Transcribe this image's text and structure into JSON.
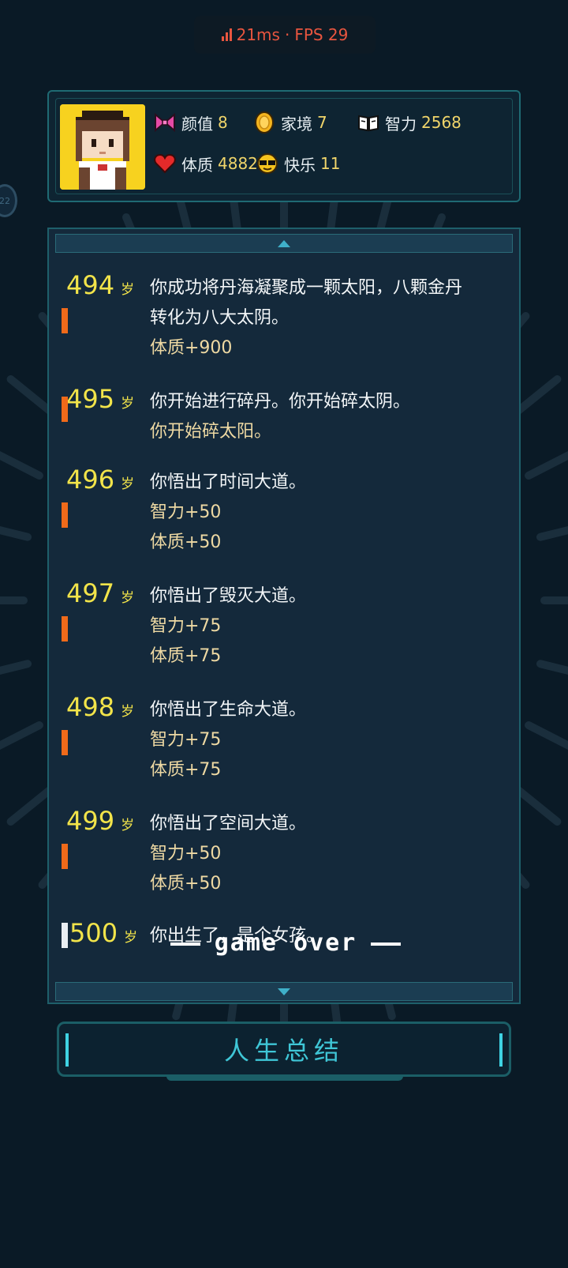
{
  "perf": {
    "latency": "21ms",
    "separator": "·",
    "fps": "FPS 29"
  },
  "side_badge": "22",
  "attributes": [
    {
      "name": "颜值",
      "value": "8",
      "icon": "bow-icon"
    },
    {
      "name": "家境",
      "value": "7",
      "icon": "coin-icon"
    },
    {
      "name": "智力",
      "value": "2568",
      "icon": "book-icon"
    },
    {
      "name": "体质",
      "value": "4882",
      "icon": "heart-icon"
    },
    {
      "name": "快乐",
      "value": "11",
      "icon": "sunglasses-icon"
    }
  ],
  "log": {
    "age_unit": "岁",
    "entries": [
      {
        "age": "494",
        "lines": [
          "你成功将丹海凝聚成一颗太阳，八颗金丹",
          "转化为八大太阴。"
        ],
        "subs": [
          "体质+900"
        ]
      },
      {
        "age": "495",
        "lines": [
          "你开始进行碎丹。你开始碎太阴。"
        ],
        "subs": [
          "你开始碎太阳。"
        ]
      },
      {
        "age": "496",
        "lines": [
          "你悟出了时间大道。"
        ],
        "subs": [
          "智力+50",
          "体质+50"
        ]
      },
      {
        "age": "497",
        "lines": [
          "你悟出了毁灭大道。"
        ],
        "subs": [
          "智力+75",
          "体质+75"
        ]
      },
      {
        "age": "498",
        "lines": [
          "你悟出了生命大道。"
        ],
        "subs": [
          "智力+75",
          "体质+75"
        ]
      },
      {
        "age": "499",
        "lines": [
          "你悟出了空间大道。"
        ],
        "subs": [
          "智力+50",
          "体质+50"
        ]
      },
      {
        "age": "500",
        "lines": [
          "你出生了，是个女孩。"
        ],
        "subs": []
      }
    ],
    "game_over": "game over"
  },
  "summary_button": "人生总结",
  "colors": {
    "background": "#0a1a26",
    "panel": "#14293b",
    "border": "#1e5f6a",
    "age": "#f2e44a",
    "marker": "#f06a1a",
    "sub_text": "#eed9a3",
    "button_text": "#3fc6d6"
  }
}
